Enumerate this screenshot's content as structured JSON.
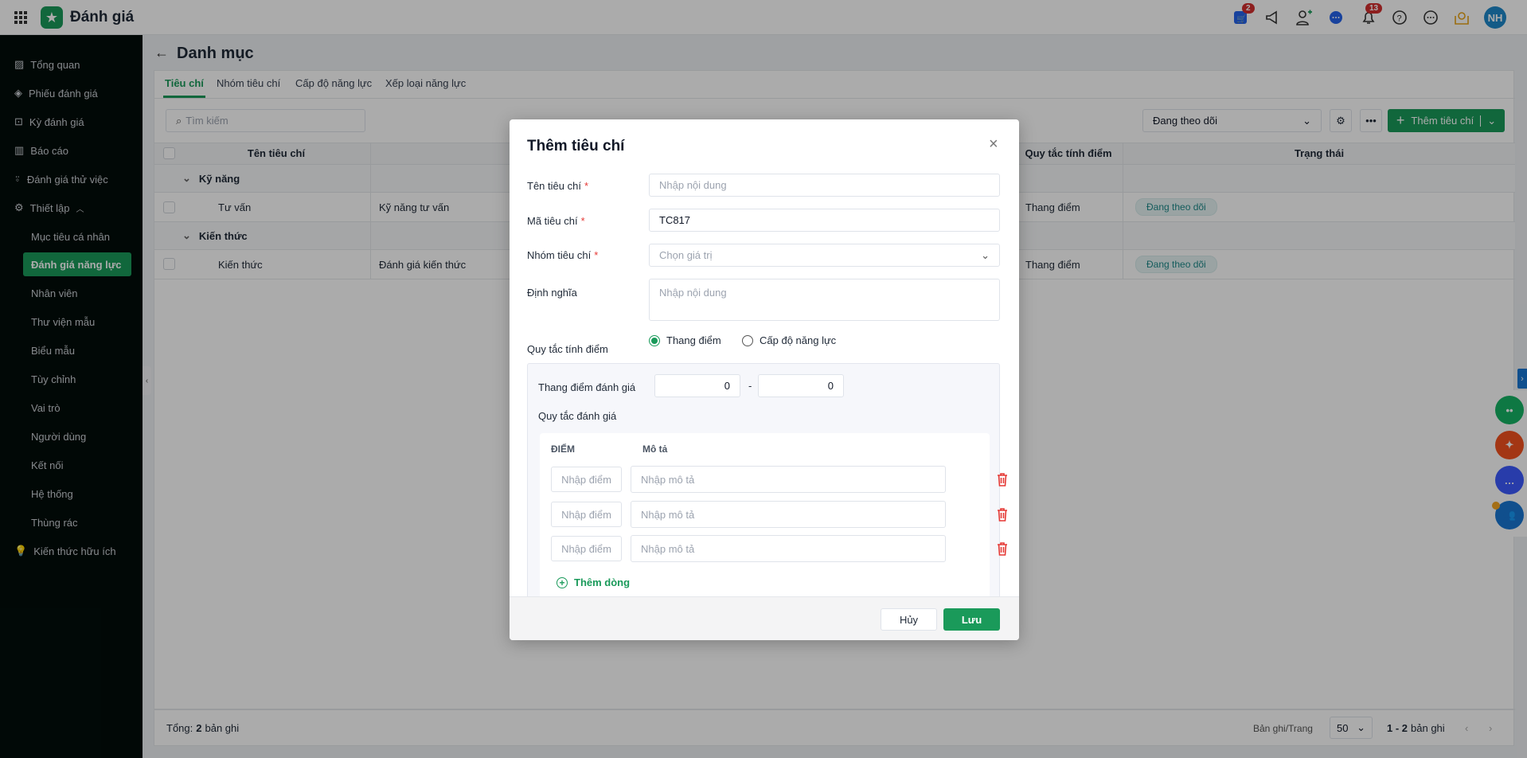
{
  "app": {
    "title": "Đánh giá",
    "avatar_initials": "NH",
    "cart_badge": "2",
    "bell_badge": "13"
  },
  "sidebar": {
    "items": [
      {
        "label": "Tổng quan"
      },
      {
        "label": "Phiếu đánh giá"
      },
      {
        "label": "Kỳ đánh giá"
      },
      {
        "label": "Báo cáo"
      },
      {
        "label": "Đánh giá thử việc"
      },
      {
        "label": "Thiết lập"
      }
    ],
    "sub_items": [
      {
        "label": "Mục tiêu cá nhân"
      },
      {
        "label": "Đánh giá năng lực"
      },
      {
        "label": "Nhân viên"
      },
      {
        "label": "Thư viện mẫu"
      },
      {
        "label": "Biểu mẫu"
      },
      {
        "label": "Tùy chỉnh"
      },
      {
        "label": "Vai trò"
      },
      {
        "label": "Người dùng"
      },
      {
        "label": "Kết nối"
      },
      {
        "label": "Hệ thống"
      },
      {
        "label": "Thùng rác"
      }
    ],
    "footer_item": "Kiến thức hữu ích"
  },
  "page": {
    "title": "Danh mục",
    "tabs": [
      {
        "label": "Tiêu chí"
      },
      {
        "label": "Nhóm tiêu chí"
      },
      {
        "label": "Cấp độ năng lực"
      },
      {
        "label": "Xếp loại năng lực"
      }
    ],
    "search_placeholder": "Tìm kiếm",
    "filter_value": "Đang theo dõi",
    "add_button": "Thêm tiêu chí",
    "columns": [
      "Tên tiêu chí",
      "Quy tắc tính điểm",
      "Trạng thái"
    ],
    "groups": [
      {
        "name": "Kỹ năng",
        "rows": [
          {
            "name": "Tư vấn",
            "definition": "Kỹ năng tư vấn",
            "rule": "Thang điểm",
            "status": "Đang theo dõi"
          }
        ]
      },
      {
        "name": "Kiến thức",
        "rows": [
          {
            "name": "Kiến thức",
            "definition": "Đánh giá kiến thức",
            "rule": "Thang điểm",
            "status": "Đang theo dõi"
          }
        ]
      }
    ],
    "footer": {
      "total_label": "Tổng:",
      "total": "2",
      "total_unit": "bản ghi",
      "per_page_label": "Bản ghi/Trang",
      "per_page": "50",
      "range": "1 - 2",
      "range_unit": "bản ghi"
    }
  },
  "modal": {
    "title": "Thêm tiêu chí",
    "name_label": "Tên tiêu chí",
    "name_placeholder": "Nhập nội dung",
    "code_label": "Mã tiêu chí",
    "code_value": "TC817",
    "group_label": "Nhóm tiêu chí",
    "group_placeholder": "Chọn giá trị",
    "definition_label": "Định nghĩa",
    "definition_placeholder": "Nhập nội dung",
    "rule_label": "Quy tắc tính điểm",
    "rule_options": [
      {
        "label": "Thang điểm",
        "selected": true
      },
      {
        "label": "Cấp độ năng lực",
        "selected": false
      }
    ],
    "scale_label": "Thang điểm đánh giá",
    "scale_min": "0",
    "scale_sep": "-",
    "scale_max": "0",
    "eval_rules_label": "Quy tắc đánh giá",
    "score_header": "ĐIỂM",
    "desc_header": "Mô tả",
    "rows": [
      {
        "score_placeholder": "Nhập điểm",
        "desc_placeholder": "Nhập mô tả"
      },
      {
        "score_placeholder": "Nhập điểm",
        "desc_placeholder": "Nhập mô tả"
      },
      {
        "score_placeholder": "Nhập điểm",
        "desc_placeholder": "Nhập mô tả"
      }
    ],
    "add_row": "Thêm dòng",
    "cancel": "Hủy",
    "save": "Lưu"
  },
  "colors": {
    "brand": "#1a9a5a",
    "danger": "#e53935"
  }
}
